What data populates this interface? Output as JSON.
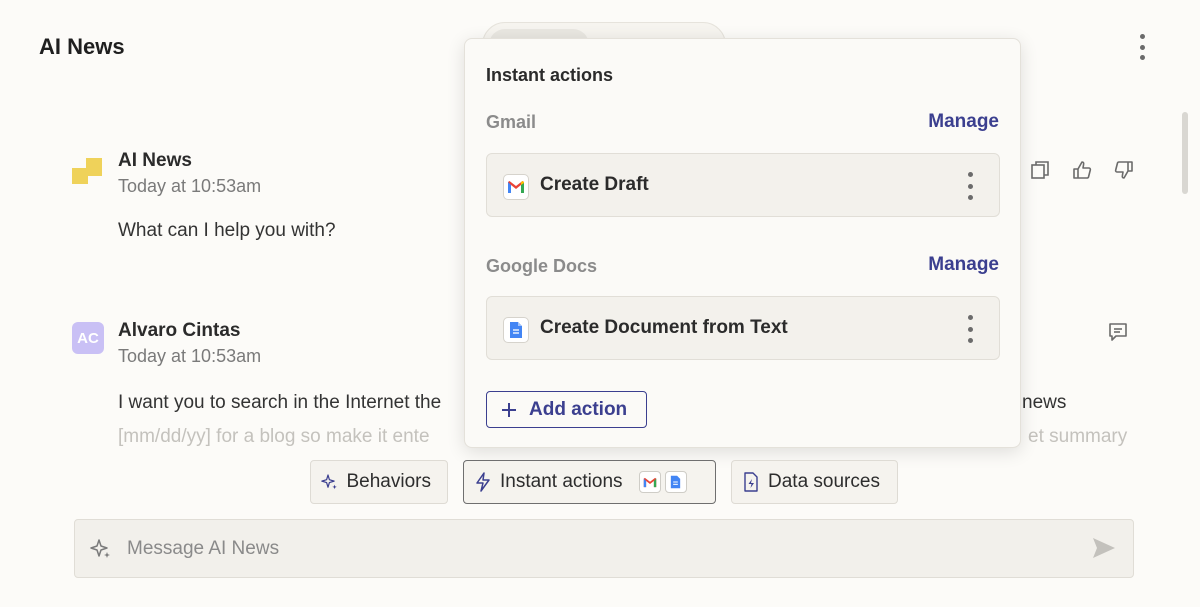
{
  "header": {
    "title": "AI News"
  },
  "messages": [
    {
      "author": "AI News",
      "time": "Today at 10:53am",
      "text": "What can I help you with?",
      "avatar": "ai-news-logo"
    },
    {
      "author": "Alvaro Cintas",
      "time": "Today at 10:53am",
      "avatar_initials": "AC",
      "text_line1_start": "I want you to search in the Internet the",
      "text_line1_end": "news",
      "text_line2_start": "[mm/dd/yy] for a blog so make it ente",
      "text_line2_end": "et summary"
    }
  ],
  "popover": {
    "title": "Instant actions",
    "groups": [
      {
        "label": "Gmail",
        "manage_label": "Manage",
        "action": "Create Draft",
        "icon": "gmail-icon"
      },
      {
        "label": "Google Docs",
        "manage_label": "Manage",
        "action": "Create Document from Text",
        "icon": "google-docs-icon"
      }
    ],
    "add_action_label": "Add action"
  },
  "chips": {
    "behaviors": "Behaviors",
    "instant_actions": "Instant actions",
    "data_sources": "Data sources"
  },
  "composer": {
    "placeholder": "Message AI News"
  },
  "colors": {
    "accent": "#3b3f8f",
    "logo_yellow": "#efd25a",
    "avatar_purple": "#c9c0f5"
  }
}
